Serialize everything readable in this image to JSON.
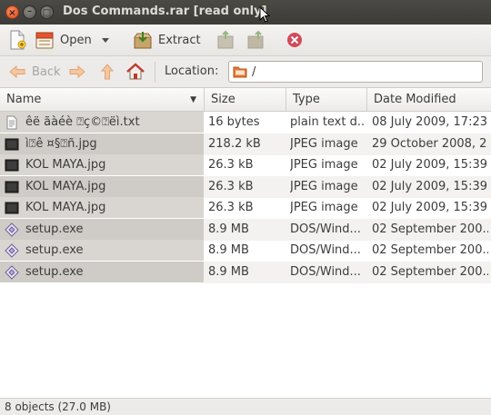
{
  "window": {
    "title": "Dos Commands.rar [read only]",
    "close_glyph": "×",
    "min_glyph": "–",
    "max_glyph": "□"
  },
  "toolbar": {
    "open_label": "Open",
    "extract_label": "Extract"
  },
  "location": {
    "back_label": "Back",
    "label": "Location:",
    "path": "/"
  },
  "columns": {
    "name": "Name",
    "size": "Size",
    "type": "Type",
    "modified": "Date Modified"
  },
  "files": [
    {
      "name": "êë ãàéè ⍰ç©⍰ëì.txt",
      "size": "16 bytes",
      "type": "plain text d...",
      "modified": "08 July 2009, 17:23",
      "icon": "text-file-icon"
    },
    {
      "name": "ì⍰ê ¤§⍰ñ.jpg",
      "size": "218.2 kB",
      "type": "JPEG image",
      "modified": "29 October 2008, 2...",
      "icon": "image-file-icon"
    },
    {
      "name": "KOL MAYA.jpg",
      "size": "26.3 kB",
      "type": "JPEG image",
      "modified": "02 July 2009, 15:39",
      "icon": "image-file-icon"
    },
    {
      "name": "KOL MAYA.jpg",
      "size": "26.3 kB",
      "type": "JPEG image",
      "modified": "02 July 2009, 15:39",
      "icon": "image-file-icon"
    },
    {
      "name": "KOL MAYA.jpg",
      "size": "26.3 kB",
      "type": "JPEG image",
      "modified": "02 July 2009, 15:39",
      "icon": "image-file-icon"
    },
    {
      "name": "setup.exe",
      "size": "8.9 MB",
      "type": "DOS/Wind...",
      "modified": "02 September 200...",
      "icon": "executable-file-icon"
    },
    {
      "name": "setup.exe",
      "size": "8.9 MB",
      "type": "DOS/Wind...",
      "modified": "02 September 200...",
      "icon": "executable-file-icon"
    },
    {
      "name": "setup.exe",
      "size": "8.9 MB",
      "type": "DOS/Wind...",
      "modified": "02 September 200...",
      "icon": "executable-file-icon"
    }
  ],
  "status": {
    "text": "8 objects (27.0 MB)"
  },
  "colors": {
    "titlebar": "#3c3b37",
    "close_button": "#de4a1c",
    "name_column_bg": "#d9d6d1",
    "folder_icon": "#e9772f",
    "stop_icon": "#c7162b"
  }
}
